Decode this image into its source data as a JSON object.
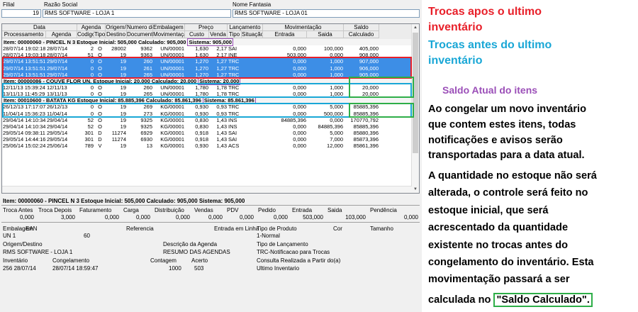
{
  "header": {
    "filial_label": "Filial",
    "razao_label": "Razão Social",
    "nome_label": "Nome Fantasia",
    "filial_value": "19",
    "razao_value": "RMS SOFTWARE - LOJA 1",
    "nome_value": "RMS SOFTWARE - LOJA 01"
  },
  "grid": {
    "groups": [
      "Data",
      "Agenda",
      "Origem/",
      "Numero do",
      "Embalagem de",
      "Preço",
      "Lançamento",
      "Movimentação",
      "Saldo"
    ],
    "columns": [
      "Processamento",
      "Agenda",
      "Codigo",
      "Tipo",
      "Destino",
      "Documento",
      "Movimentação",
      "Custo",
      "Venda",
      "Tipo",
      "Situação",
      "Entrada",
      "Saida",
      "Calculado"
    ],
    "items": [
      {
        "header": "Item: 00000060 - PINCEL N 3  Estoque Inicial: 505,000  Calculado: 905,000",
        "sistema": "Sistema: 905,000",
        "rows": [
          [
            "28/07/14 19:02:18",
            "28/07/14",
            "2",
            "O",
            "28002",
            "9362",
            "UN/00001",
            "1,630",
            "2,17",
            "SAI",
            "",
            "0,000",
            "100,000",
            "405,000"
          ],
          [
            "28/07/14 19:03:18",
            "28/07/14",
            "51",
            "O",
            "19",
            "9363",
            "UN/00001",
            "1,630",
            "2,17",
            "INE",
            "",
            "503,000",
            "0,000",
            "908,000"
          ],
          [
            "29/07/14 13:51:51",
            "29/07/14",
            "0",
            "O",
            "19",
            "260",
            "UN/00001",
            "1,270",
            "1,27",
            "TRC",
            "",
            "0,000",
            "1,000",
            "907,000"
          ],
          [
            "29/07/14 13:51:51",
            "29/07/14",
            "0",
            "O",
            "19",
            "261",
            "UN/00001",
            "1,270",
            "1,27",
            "TRC",
            "",
            "0,000",
            "1,000",
            "906,000"
          ],
          [
            "29/07/14 13:51:51",
            "29/07/14",
            "0",
            "O",
            "19",
            "265",
            "UN/00001",
            "1,270",
            "1,27",
            "TRC",
            "",
            "0,000",
            "1,000",
            "905,000"
          ]
        ]
      },
      {
        "header": "Item: 00000086 - COUVE FLOR UN.  Estoque Inicial: 20,000  Calculado: 20,000",
        "sistema": "Sistema: 20,000",
        "rows": [
          [
            "12/11/13 15:39:24",
            "12/11/13",
            "0",
            "O",
            "19",
            "260",
            "UN/00001",
            "1,780",
            "1,78",
            "TRC",
            "",
            "0,000",
            "1,000",
            "20,000"
          ],
          [
            "13/11/13 11:45:29",
            "13/11/13",
            "0",
            "O",
            "19",
            "265",
            "UN/00001",
            "1,780",
            "1,78",
            "TRC",
            "",
            "0,000",
            "1,000",
            "20,000"
          ]
        ]
      },
      {
        "header": "Item: 00010600 - BATATA KG  Estoque Inicial: 85.885,396  Calculado: 85.861,396",
        "sistema": "Sistema: 85.861,396",
        "rows": [
          [
            "26/12/13 17:17:07",
            "26/12/13",
            "0",
            "O",
            "19",
            "269",
            "KG/00001",
            "0,930",
            "0,93",
            "TRC",
            "",
            "0,000",
            "5,000",
            "85885,396"
          ],
          [
            "11/04/14 15:36:23",
            "11/04/14",
            "0",
            "O",
            "19",
            "273",
            "KG/00001",
            "0,930",
            "0,93",
            "TRC",
            "",
            "0,000",
            "500,000",
            "85885,396"
          ],
          [
            "29/04/14 14:10:34",
            "29/04/14",
            "52",
            "O",
            "19",
            "9325",
            "KG/00001",
            "0,830",
            "1,43",
            "INS",
            "",
            "84885,396",
            "0,000",
            "170770,792"
          ],
          [
            "29/04/14 14:10:34",
            "29/04/14",
            "52",
            "O",
            "19",
            "9325",
            "KG/00001",
            "0,830",
            "1,43",
            "INS",
            "",
            "0,000",
            "84885,396",
            "85885,396"
          ],
          [
            "29/05/14 09:38:11",
            "29/05/14",
            "301",
            "D",
            "11274",
            "6929",
            "KG/00001",
            "0,918",
            "1,43",
            "SAI",
            "",
            "0,000",
            "5,000",
            "85880,396"
          ],
          [
            "29/05/14 14:44:16",
            "29/05/14",
            "301",
            "D",
            "11274",
            "6930",
            "KG/00001",
            "0,918",
            "1,43",
            "SAI",
            "",
            "0,000",
            "7,000",
            "85873,396"
          ],
          [
            "25/06/14 15:02:24",
            "25/06/14",
            "789",
            "V",
            "19",
            "13",
            "KG/00001",
            "0,930",
            "1,43",
            "ACS",
            "",
            "0,000",
            "12,000",
            "85861,396"
          ]
        ]
      }
    ]
  },
  "detail": {
    "title": "Item: 00000060 - PINCEL N 3  Estoque Inicial: 505,000  Calculado: 905,000  Sistema: 905,000",
    "mov_labels": [
      "Troca Antes",
      "Troca Depois",
      "Faturamento",
      "Carga",
      "Distribuição",
      "Vendas",
      "PDV",
      "Pedido",
      "Entrada",
      "Saida",
      "Pendência"
    ],
    "mov_values": [
      "0,000",
      "3,000",
      "0,000",
      "0,000",
      "0,000",
      "0,000",
      "0,000",
      "0,000",
      "503,000",
      "103,000",
      "0,000"
    ],
    "row1_labels": [
      "Embalagem",
      "EAN",
      "Referencia",
      "Entrada em Linha",
      "Tipo de Produto",
      "Cor",
      "Tamanho"
    ],
    "row1_values": [
      "UN  1",
      "60",
      "1-Normal"
    ],
    "row2_labels": [
      "Origem/Destino",
      "Descrição da Agenda",
      "Tipo de Lançamento"
    ],
    "row2_values": [
      "RMS SOFTWARE - LOJA 1",
      "RESUMO DAS AGENDAS",
      "TRC-Notificacao para Trocas"
    ],
    "row3_labels": [
      "Inventário",
      "Congelamento",
      "Contagem",
      "Acerto",
      "Consulta Realizada a Partir do(a)"
    ],
    "row3_values": [
      "256 28/07/14",
      "28/07/14 18:59:47",
      "1000",
      "503",
      "Ultimo Inventario"
    ]
  },
  "notes": {
    "n1a": "Trocas apos o ultimo",
    "n1b": "inventário",
    "n2a": "Trocas antes do ultimo",
    "n2b": "inventário",
    "n3": "Saldo Atual do itens",
    "p1": [
      "Ao congelar um novo inventário",
      "que contem estes itens, todas",
      "notificações e avisos serão",
      "transportadas para a data atual."
    ],
    "p2": [
      "A quantidade no estoque não será",
      "alterada, o controle será feito no",
      "estoque inicial, que será",
      "acrescentado da quantidade",
      "existente no trocas antes do",
      "congelamento do inventário. Esta",
      "movimentação passará a ser"
    ],
    "p2_last_prefix": "calculada no ",
    "p2_last_highlight": "\"Saldo Calculado\".",
    "color_red": "#e8202a",
    "color_cyan": "#19a7d6",
    "color_purple": "#9b4fb8",
    "color_green": "#2eae48"
  }
}
